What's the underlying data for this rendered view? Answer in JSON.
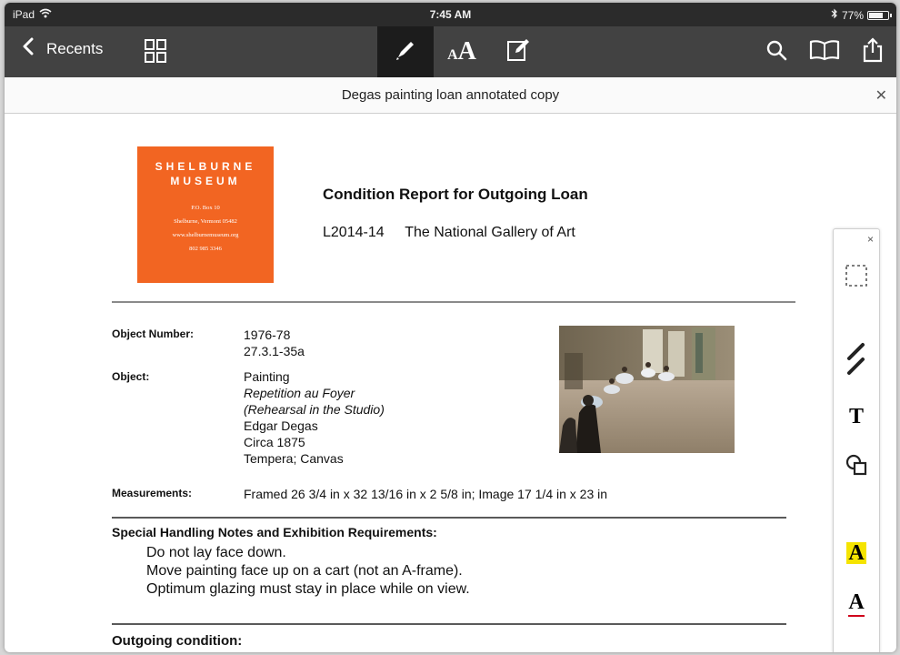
{
  "status": {
    "device": "iPad",
    "time": "7:45 AM",
    "battery": "77%",
    "battery_level": 0.77
  },
  "toolbar": {
    "back_label": "Recents"
  },
  "document": {
    "title": "Degas painting loan annotated copy"
  },
  "logo": {
    "name": "SHELBURNE\nMUSEUM",
    "lines": "P.O. Box 10\nShelburne, Vermont 05482\nwww.shelburnemuseum.org\n802 985 3346"
  },
  "report": {
    "title": "Condition Report for Outgoing Loan",
    "loan_number": "L2014-14",
    "borrower": "The National Gallery of Art"
  },
  "fields": {
    "object_number_label": "Object Number:",
    "object_number_values": [
      "1976-78",
      "27.3.1-35a"
    ],
    "object_label": "Object:",
    "object_values": [
      {
        "text": "Painting",
        "italic": false
      },
      {
        "text": "Repetition au Foyer",
        "italic": true
      },
      {
        "text": "(Rehearsal in the Studio)",
        "italic": true
      },
      {
        "text": "Edgar Degas",
        "italic": false
      },
      {
        "text": "Circa 1875",
        "italic": false
      },
      {
        "text": "Tempera; Canvas",
        "italic": false
      }
    ],
    "measurements_label": "Measurements:",
    "measurements_value": "Framed 26 3/4 in x 32 13/16 in x 2 5/8 in; Image 17 1/4 in x 23 in"
  },
  "special_handling": {
    "heading": "Special Handling Notes and Exhibition Requirements:",
    "notes": [
      "Do not lay face down.",
      "Move painting face up on a cart (not an A-frame).",
      "Optimum glazing must stay in place while on view."
    ]
  },
  "outgoing": {
    "heading": "Outgoing condition:"
  },
  "palette": {
    "close": "×",
    "text_tool": "T",
    "highlight_tool": "A",
    "underline_tool": "A",
    "highlight_color": "#f5e400",
    "underline_color": "#d0021b"
  },
  "colors": {
    "logo_bg": "#f26522",
    "toolbar_bg": "#424242",
    "status_bg": "#2b2b2b"
  }
}
